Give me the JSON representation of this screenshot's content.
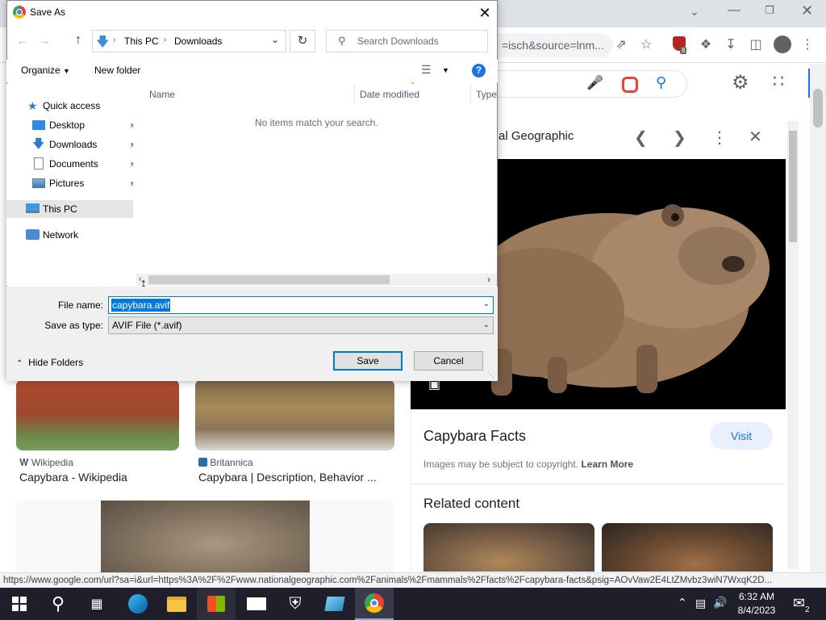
{
  "browser": {
    "omnibox_text": "=isch&source=lnm...",
    "status_url": "https://www.google.com/url?sa=i&url=https%3A%2F%2Fwww.nationalgeographic.com%2Fanimals%2Fmammals%2Ffacts%2Fcapybara-facts&psig=AOvVaw2E4LtZMvbz3wiN7WxqK2D...",
    "extension_badge": "8"
  },
  "panel": {
    "source": "al Geographic",
    "title": "Capybara Facts",
    "visit_label": "Visit",
    "copyright_text": "Images may be subject to copyright.",
    "learn_more": "Learn More",
    "related_heading": "Related content"
  },
  "results": [
    {
      "source": "Wikipedia",
      "title": "Capybara - Wikipedia"
    },
    {
      "source": "Britannica",
      "title": "Capybara | Description, Behavior ..."
    }
  ],
  "dialog": {
    "title": "Save As",
    "breadcrumb": [
      "This PC",
      "Downloads"
    ],
    "search_placeholder": "Search Downloads",
    "organize_label": "Organize",
    "new_folder_label": "New folder",
    "columns": [
      "Name",
      "Date modified",
      "Type"
    ],
    "empty_message": "No items match your search.",
    "nav": {
      "quick_access": "Quick access",
      "items": [
        "Desktop",
        "Downloads",
        "Documents",
        "Pictures"
      ],
      "this_pc": "This PC",
      "network": "Network"
    },
    "file_name_label": "File name:",
    "file_name_value": "capybara.avif",
    "save_type_label": "Save as type:",
    "save_type_value": "AVIF File (*.avif)",
    "save_label": "Save",
    "cancel_label": "Cancel",
    "hide_folders_label": "Hide Folders"
  },
  "taskbar": {
    "time": "6:32 AM",
    "date": "8/4/2023",
    "notification_count": "2"
  },
  "colors": {
    "accent": "#0078d7",
    "google_blue": "#1a73e8",
    "taskbar": "#1f1f2b"
  }
}
